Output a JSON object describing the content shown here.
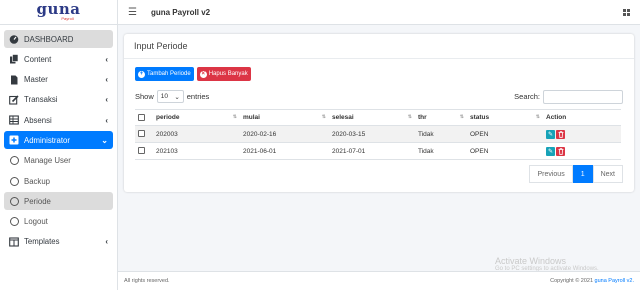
{
  "logo": {
    "main": "guna",
    "sub": "Payroll"
  },
  "header": {
    "title": "guna Payroll v2"
  },
  "sidebar": {
    "items": [
      {
        "label": "DASHBOARD"
      },
      {
        "label": "Content"
      },
      {
        "label": "Master"
      },
      {
        "label": "Transaksi"
      },
      {
        "label": "Absensi"
      },
      {
        "label": "Administrator"
      },
      {
        "label": "Manage User"
      },
      {
        "label": "Backup"
      },
      {
        "label": "Periode"
      },
      {
        "label": "Logout"
      },
      {
        "label": "Templates"
      }
    ]
  },
  "card": {
    "title": "Input Periode",
    "add_button": "Tambah Periode",
    "delete_button": "Hapus Banyak",
    "show_label": "Show",
    "entries_value": "10",
    "entries_label": "entries",
    "search_label": "Search:"
  },
  "table": {
    "columns": [
      "periode",
      "mulai",
      "selesai",
      "thr",
      "status",
      "Action"
    ],
    "rows": [
      {
        "periode": "202003",
        "mulai": "2020-02-16",
        "selesai": "2020-03-15",
        "thr": "Tidak",
        "status": "OPEN"
      },
      {
        "periode": "202103",
        "mulai": "2021-06-01",
        "selesai": "2021-07-01",
        "thr": "Tidak",
        "status": "OPEN"
      }
    ]
  },
  "pagination": {
    "previous": "Previous",
    "page": "1",
    "next": "Next"
  },
  "footer": {
    "left": "All rights reserved.",
    "right_prefix": "Copyright © 2021",
    "right_link": "guna Payroll v2."
  },
  "watermark": {
    "title": "Activate Windows",
    "subtitle": "Go to PC settings to activate Windows."
  },
  "colors": {
    "primary": "#007bff",
    "danger": "#dc3545",
    "info": "#17a2b8",
    "logo": "#2c3a86"
  }
}
